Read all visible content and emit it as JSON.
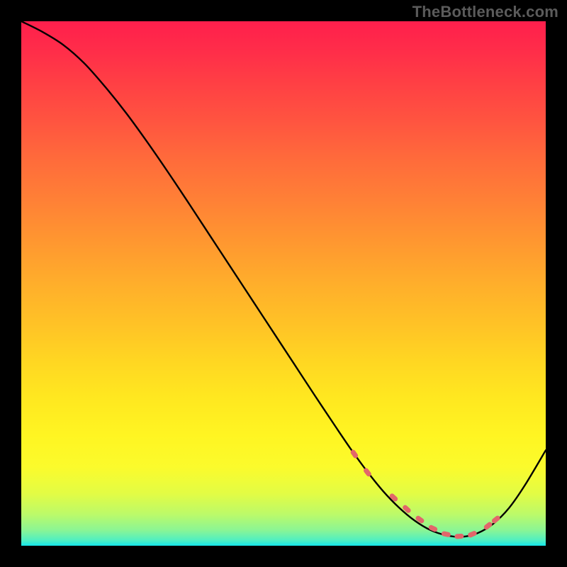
{
  "watermark": "TheBottleneck.com",
  "colors": {
    "frame": "#000000",
    "gradient_top": "#ff1f4c",
    "gradient_bottom": "#14e6eb",
    "curve": "#000000",
    "marker": "#e2666a"
  },
  "chart_data": {
    "type": "line",
    "title": "",
    "xlabel": "",
    "ylabel": "",
    "xlim": [
      0,
      100
    ],
    "ylim": [
      0,
      100
    ],
    "series": [
      {
        "name": "bottleneck-curve",
        "x": [
          0,
          4,
          8,
          12,
          16,
          20,
          24,
          28,
          32,
          36,
          40,
          44,
          48,
          52,
          56,
          60,
          63,
          66,
          69,
          72,
          75,
          78,
          81,
          84,
          87,
          90,
          93,
          96,
          100
        ],
        "y": [
          100,
          98,
          95.5,
          92,
          87.5,
          82.5,
          77,
          71.2,
          65.2,
          59.1,
          53,
          46.9,
          40.8,
          34.7,
          28.6,
          22.6,
          18.2,
          14.1,
          10.4,
          7.3,
          4.8,
          3.0,
          2.0,
          1.7,
          2.4,
          4.2,
          7.2,
          11.5,
          18.2
        ]
      }
    ],
    "markers": {
      "name": "highlight-dots",
      "x": [
        63.5,
        66.0,
        71.0,
        73.5,
        76.0,
        78.5,
        81.0,
        83.5,
        86.0,
        89.0,
        90.5
      ],
      "y": [
        17.5,
        14.0,
        9.2,
        7.0,
        5.0,
        3.3,
        2.2,
        1.8,
        2.2,
        3.8,
        5.0
      ]
    }
  }
}
